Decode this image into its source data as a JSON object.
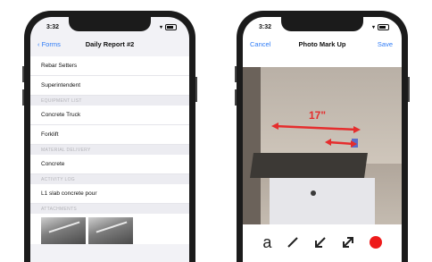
{
  "left_phone": {
    "status": {
      "time": "3:32"
    },
    "nav": {
      "back_label": "Forms",
      "title": "Daily Report #2"
    },
    "rows": [
      {
        "type": "row",
        "label": "Rebar Setters"
      },
      {
        "type": "row",
        "label": "Superintendent"
      },
      {
        "type": "section",
        "label": "EQUIPMENT LIST"
      },
      {
        "type": "row",
        "label": "Concrete Truck"
      },
      {
        "type": "row",
        "label": "Forklift"
      },
      {
        "type": "section",
        "label": "MATERIAL DELIVERY"
      },
      {
        "type": "row",
        "label": "Concrete"
      },
      {
        "type": "section",
        "label": "ACTIVITY LOG"
      },
      {
        "type": "row",
        "label": "L1 slab concrete pour"
      },
      {
        "type": "section",
        "label": "ATTACHMENTS"
      }
    ]
  },
  "right_phone": {
    "status": {
      "time": "3:32"
    },
    "nav": {
      "cancel_label": "Cancel",
      "title": "Photo Mark Up",
      "save_label": "Save"
    },
    "measurement": {
      "label": "17\""
    },
    "tools": {
      "text_glyph": "a",
      "text_tool": "text-tool-icon",
      "line_tool": "line-tool-icon",
      "arrow_tool": "arrow-tool-icon",
      "double_arrow_tool": "double-arrow-tool-icon",
      "color": "#ee1b1b"
    }
  },
  "colors": {
    "accent": "#2f7cf6",
    "markup_red": "#e52d2d"
  }
}
